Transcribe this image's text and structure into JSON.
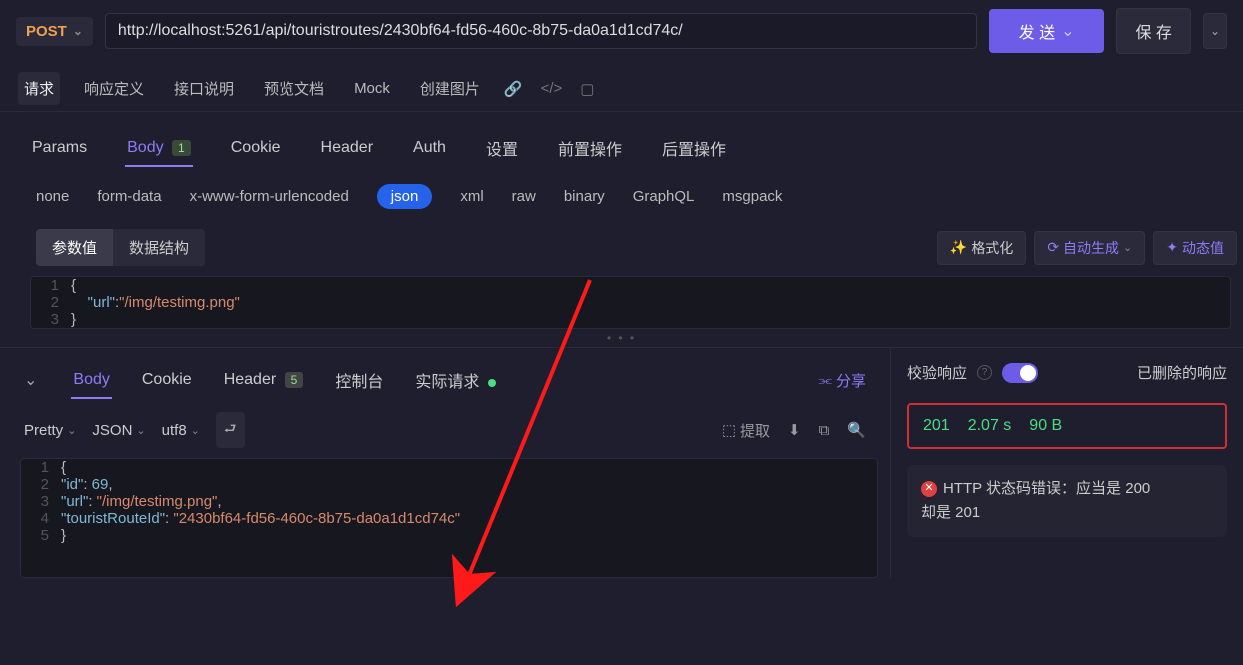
{
  "request": {
    "method": "POST",
    "url": "http://localhost:5261/api/touristroutes/2430bf64-fd56-460c-8b75-da0a1d1cd74c/",
    "send_label": "发 送",
    "save_label": "保 存"
  },
  "primary_tabs": {
    "items": [
      "请求",
      "响应定义",
      "接口说明",
      "预览文档",
      "Mock",
      "创建图片"
    ],
    "active": 0
  },
  "req_tabs": {
    "items": [
      {
        "label": "Params"
      },
      {
        "label": "Body",
        "count": "1"
      },
      {
        "label": "Cookie"
      },
      {
        "label": "Header"
      },
      {
        "label": "Auth"
      },
      {
        "label": "设置"
      },
      {
        "label": "前置操作"
      },
      {
        "label": "后置操作"
      }
    ],
    "active": 1
  },
  "body_types": {
    "items": [
      "none",
      "form-data",
      "x-www-form-urlencoded",
      "json",
      "xml",
      "raw",
      "binary",
      "GraphQL",
      "msgpack"
    ],
    "active": 3
  },
  "editor_toolbar": {
    "items": [
      "参数值",
      "数据结构"
    ],
    "active": 0,
    "format_label": "格式化",
    "autogen_label": "自动生成",
    "dynamic_label": "动态值"
  },
  "request_body_lines": [
    {
      "ln": "1",
      "html": "<span class='tok-punc'>{</span>"
    },
    {
      "ln": "2",
      "html": "    <span class='tok-key'>\"url\"</span><span class='tok-punc'>:</span><span class='tok-str'>\"/img/testimg.png\"</span>"
    },
    {
      "ln": "3",
      "html": "<span class='tok-punc'>}</span>"
    }
  ],
  "resp_tabs": {
    "items": [
      {
        "label": "Body"
      },
      {
        "label": "Cookie"
      },
      {
        "label": "Header",
        "count": "5"
      },
      {
        "label": "控制台"
      },
      {
        "label": "实际请求",
        "dot": true
      }
    ],
    "active": 0,
    "share_label": "分享"
  },
  "resp_toolbar": {
    "pretty": "Pretty",
    "format": "JSON",
    "encoding": "utf8",
    "extract_label": "提取"
  },
  "response_body_lines": [
    {
      "ln": "1",
      "html": "<span class='tok-punc'>{</span>"
    },
    {
      "ln": "2",
      "html": "    <span class='tok-key'>\"id\"</span><span class='tok-punc'>:</span> <span class='tok-num'>69</span><span class='tok-punc'>,</span>"
    },
    {
      "ln": "3",
      "html": "    <span class='tok-key'>\"url\"</span><span class='tok-punc'>:</span> <span class='tok-str'>\"/img/testimg.png\"</span><span class='tok-punc'>,</span>"
    },
    {
      "ln": "4",
      "html": "    <span class='tok-key'>\"touristRouteId\"</span><span class='tok-punc'>:</span> <span class='tok-str'>\"2430bf64-fd56-460c-8b75-da0a1d1cd74c\"</span>"
    },
    {
      "ln": "5",
      "html": "<span class='tok-punc'>}</span>"
    }
  ],
  "verify": {
    "label": "校验响应",
    "deleted_label": "已删除的响应"
  },
  "status": {
    "code": "201",
    "time": "2.07 s",
    "size": "90 B"
  },
  "error": {
    "line1": "HTTP 状态码错误：应当是 200 ",
    "line2": "却是 201"
  }
}
